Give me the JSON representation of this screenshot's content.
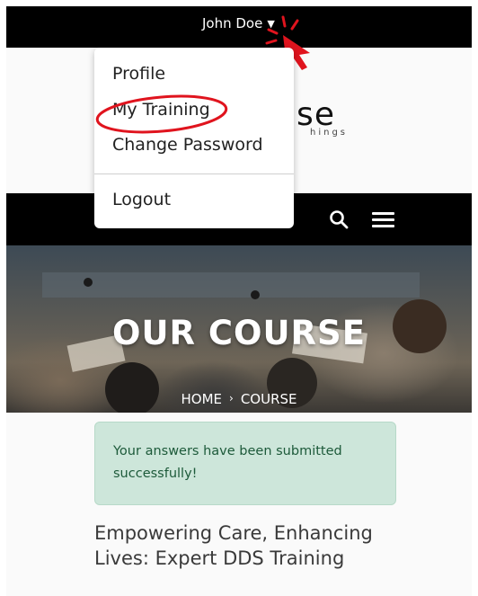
{
  "topbar": {
    "user_name": "John Doe",
    "caret": "▼"
  },
  "dropdown": {
    "items": [
      {
        "label": "Profile"
      },
      {
        "label": "My Training"
      },
      {
        "label": "Change Password"
      },
      {
        "label": "Logout"
      }
    ]
  },
  "logo": {
    "main": "ase",
    "sub": "hings"
  },
  "navbar": {
    "menu_label": "MENU"
  },
  "hero": {
    "title": "OUR COURSE"
  },
  "breadcrumb": {
    "home": "HOME",
    "separator": "›",
    "current": "COURSE"
  },
  "alert": {
    "message": "Your answers have been submitted successfully!"
  },
  "course": {
    "title": "Empowering Care, Enhancing Lives: Expert DDS Training"
  },
  "colors": {
    "topbar_bg": "#000000",
    "alert_bg": "#cde6da",
    "alert_text": "#1d5a3a",
    "annotation_red": "#e0141e"
  }
}
